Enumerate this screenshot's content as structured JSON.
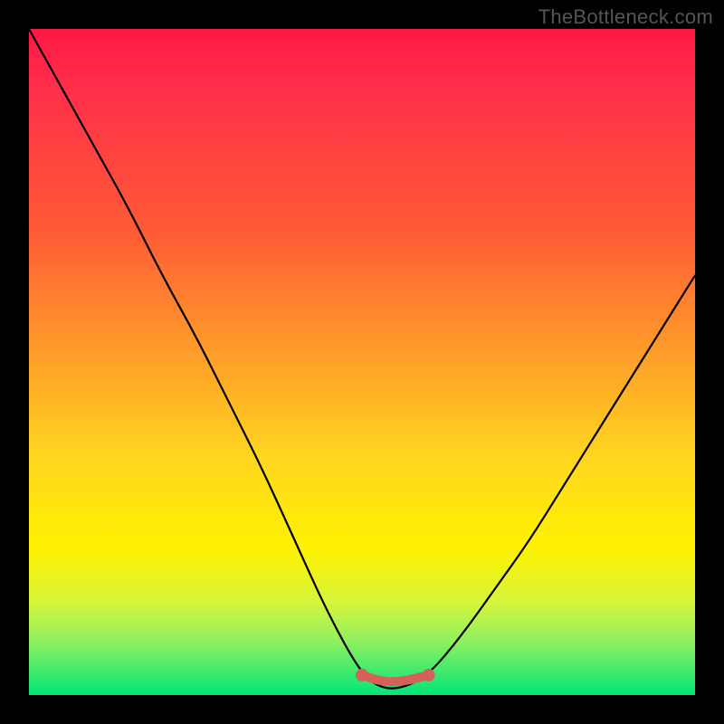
{
  "watermark": "TheBottleneck.com",
  "chart_data": {
    "type": "line",
    "title": "",
    "xlabel": "",
    "ylabel": "",
    "xlim": [
      0,
      1
    ],
    "ylim": [
      0,
      1
    ],
    "series": [
      {
        "name": "bottleneck-curve",
        "x": [
          0.0,
          0.05,
          0.1,
          0.15,
          0.2,
          0.25,
          0.3,
          0.35,
          0.4,
          0.45,
          0.5,
          0.53,
          0.56,
          0.6,
          0.65,
          0.7,
          0.75,
          0.8,
          0.85,
          0.9,
          0.95,
          1.0
        ],
        "values": [
          1.0,
          0.91,
          0.82,
          0.73,
          0.63,
          0.54,
          0.44,
          0.34,
          0.23,
          0.12,
          0.03,
          0.01,
          0.01,
          0.03,
          0.09,
          0.16,
          0.23,
          0.31,
          0.39,
          0.47,
          0.55,
          0.63
        ]
      }
    ],
    "highlight_region": {
      "x_start": 0.5,
      "x_end": 0.6,
      "y": 0.02
    },
    "colors": {
      "curve": "#000000",
      "highlight": "#d6605a",
      "background_top": "#ff1744",
      "background_bottom": "#00e676"
    }
  }
}
